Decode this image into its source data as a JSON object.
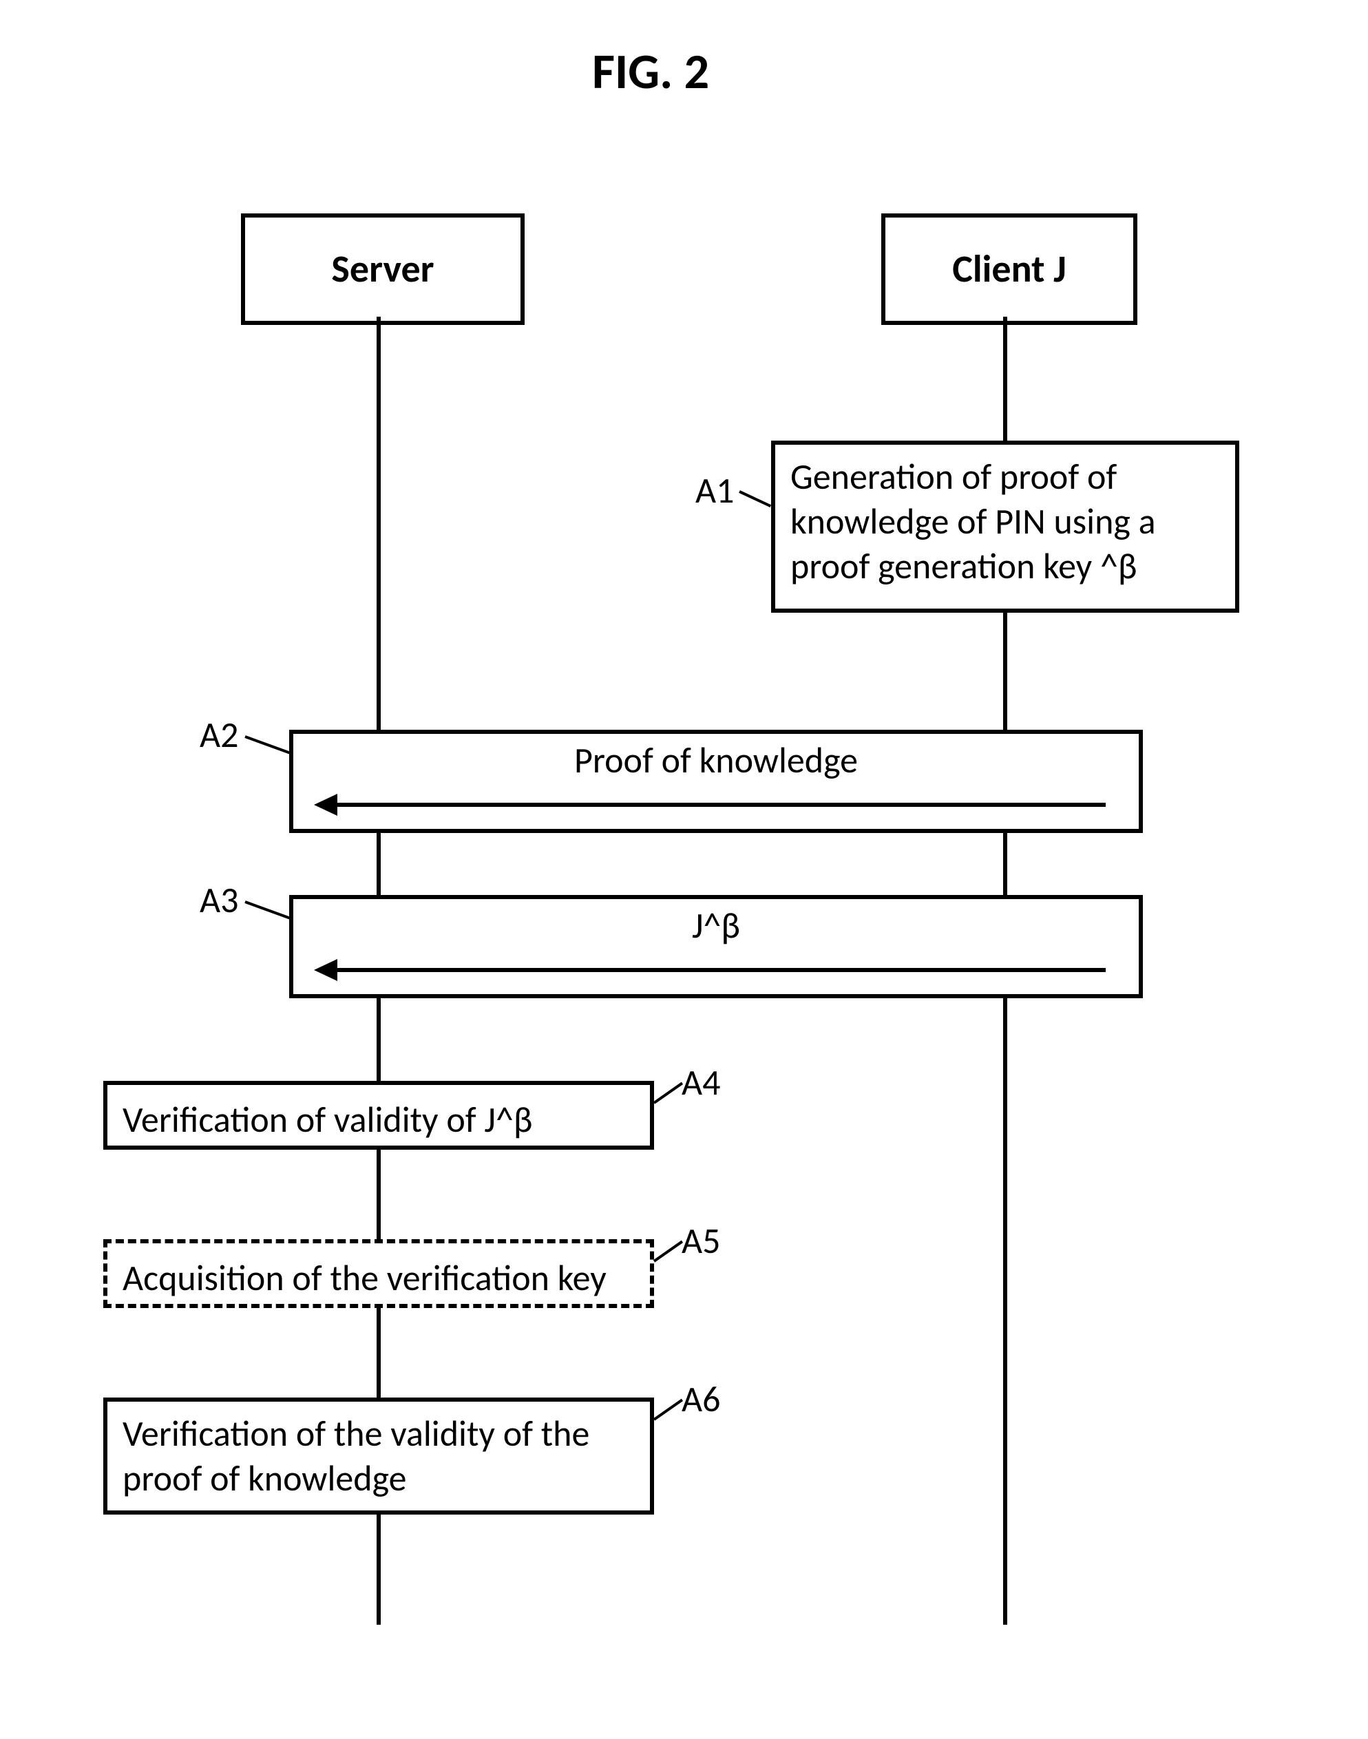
{
  "figure": {
    "title": "FIG. 2"
  },
  "actors": {
    "server": "Server",
    "client": "Client J"
  },
  "steps": {
    "a1": {
      "tag": "A1",
      "text": "Generation of proof of knowledge of PIN using a proof generation key ^β"
    },
    "a2": {
      "tag": "A2",
      "text": "Proof of knowledge"
    },
    "a3": {
      "tag": "A3",
      "text": "J^β"
    },
    "a4": {
      "tag": "A4",
      "text": "Verification of validity of J^β"
    },
    "a5": {
      "tag": "A5",
      "text": "Acquisition of the verification key"
    },
    "a6": {
      "tag": "A6",
      "text": "Verification of the validity of the proof of knowledge"
    }
  }
}
